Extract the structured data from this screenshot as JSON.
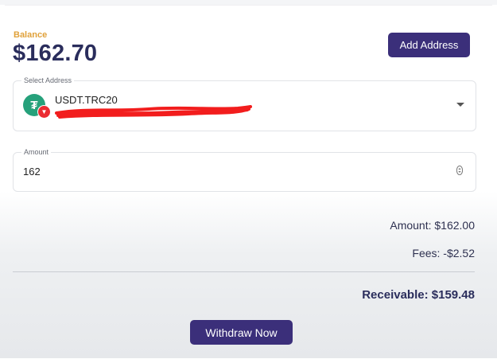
{
  "balance": {
    "label": "Balance",
    "value": "$162.70"
  },
  "add_address_button": "Add Address",
  "address_select": {
    "legend": "Select Address",
    "coin_name": "USDT.TRC20",
    "coin_icon": "tether-icon",
    "network_badge": "tron-icon"
  },
  "amount_field": {
    "legend": "Amount",
    "value": "162"
  },
  "summary": {
    "amount": "Amount: $162.00",
    "fees": "Fees: -$2.52",
    "receivable": "Receivable: $159.48"
  },
  "withdraw_button": "Withdraw Now",
  "colors": {
    "brand": "#3b2f7a",
    "balance_label": "#e0a13a",
    "tether": "#26a17b",
    "tron": "#eb2c32"
  }
}
